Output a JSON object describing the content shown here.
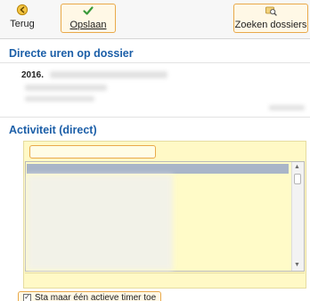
{
  "toolbar": {
    "back_label": "Terug",
    "save_label": "Opslaan",
    "search_label": "Zoeken dossiers"
  },
  "hours": {
    "title": "Directe uren op dossier",
    "year_value": "2016."
  },
  "activity": {
    "title": "Activiteit (direct)",
    "input_value": "",
    "single_timer_label": "Sta maar één actieve timer toe",
    "single_timer_checked": true
  },
  "colors": {
    "accent_title": "#1c5fa8",
    "highlight_border": "#e9a94a",
    "panel_bg": "#fff9c6",
    "selected_row": "#a9b5c8"
  },
  "icons": {
    "back": "back-arrow-circle-icon",
    "save": "checkmark-icon",
    "search": "search-folder-icon"
  }
}
